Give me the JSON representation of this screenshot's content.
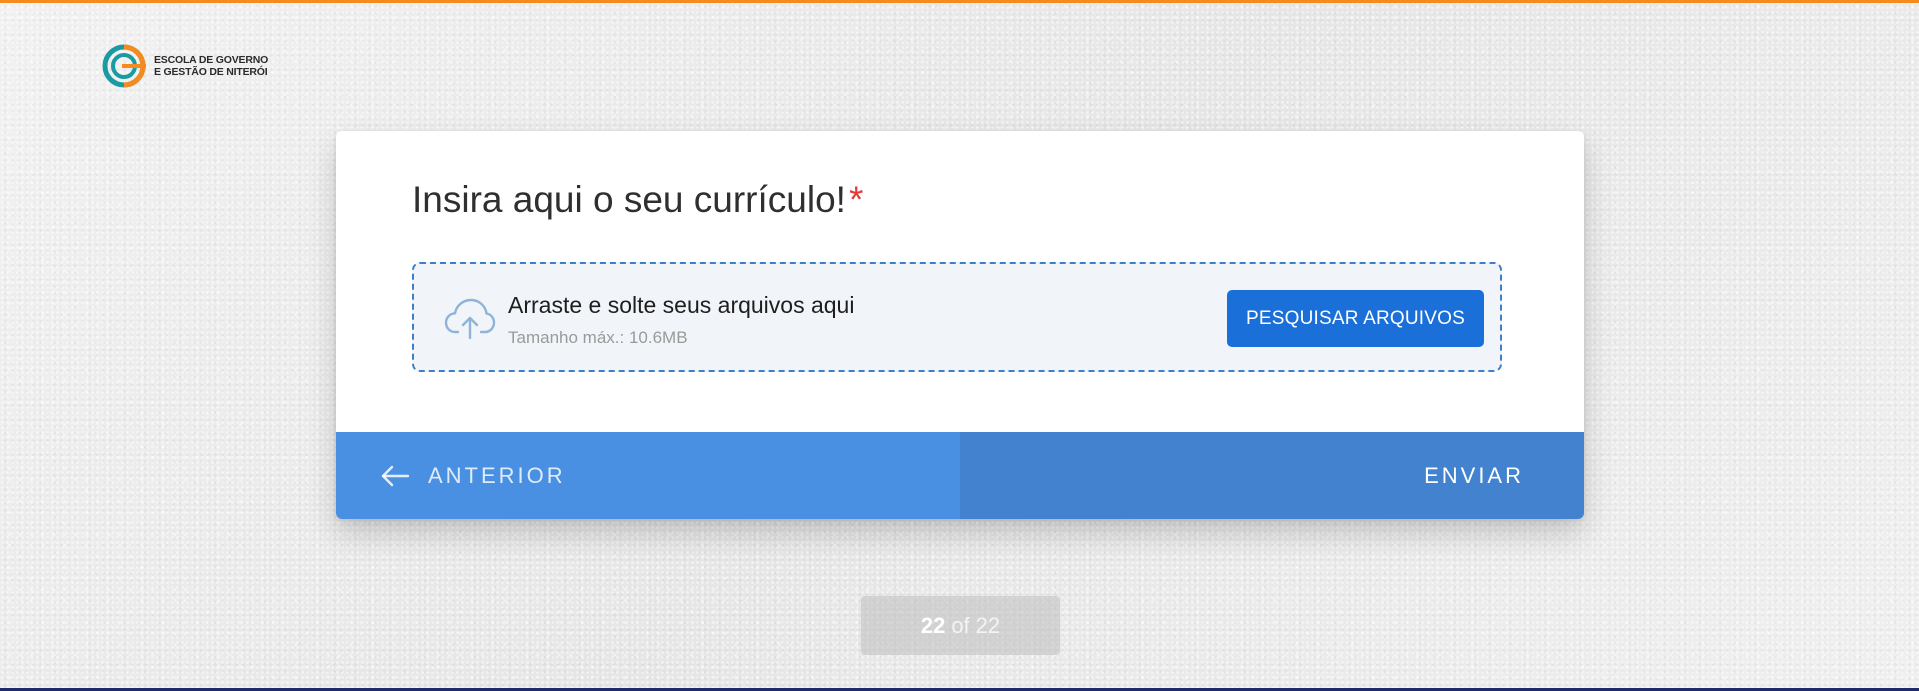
{
  "branding": {
    "logo_line1": "ESCOLA DE GOVERNO",
    "logo_line2": "E GESTÃO DE NITERÓI",
    "colors": {
      "orange": "#f58a1f",
      "teal": "#1a9aa3",
      "navy": "#1f2a6b"
    }
  },
  "question": {
    "title": "Insira aqui o seu currículo!",
    "required_mark": "*"
  },
  "upload": {
    "icon": "cloud-upload-icon",
    "title": "Arraste e solte seus arquivos aqui",
    "max_size": "Tamanho máx.: 10.6MB",
    "browse_label": "PESQUISAR ARQUIVOS"
  },
  "navigation": {
    "prev_icon": "arrow-left-icon",
    "prev_label": "ANTERIOR",
    "next_label": "ENVIAR"
  },
  "pager": {
    "current": "22",
    "of": "of",
    "total": "22"
  },
  "theme": {
    "accent": "#1a6fd8",
    "nav_prev_bg": "#4a90e2",
    "nav_next_bg": "#4282cf",
    "required": "#e53935"
  }
}
